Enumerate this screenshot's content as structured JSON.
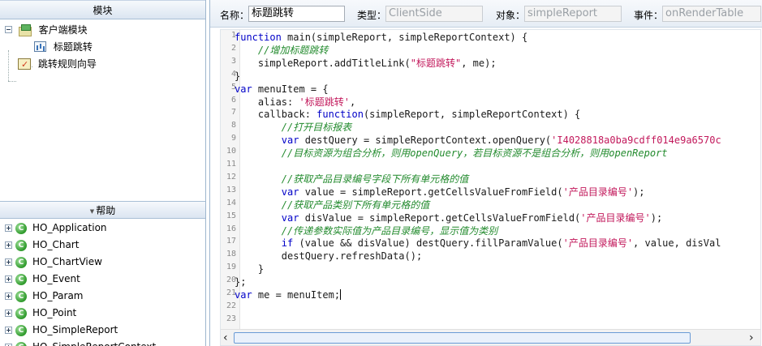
{
  "left": {
    "module_header": "模块",
    "tree": [
      {
        "label": "客户端模块",
        "icon": "folder-icon"
      },
      {
        "label": "标题跳转",
        "icon": "chart-icon"
      },
      {
        "label": "跳转规则向导",
        "icon": "guide-icon"
      }
    ],
    "help_header": "帮助",
    "help_items": [
      "HO_Application",
      "HO_Chart",
      "HO_ChartView",
      "HO_Event",
      "HO_Param",
      "HO_Point",
      "HO_SimpleReport",
      "HO_SimpleReportContext"
    ],
    "help_item_icon": "class-icon",
    "help_item_badge": "C"
  },
  "props": {
    "name_label": "名称：",
    "name_value": "标题跳转",
    "type_label": "类型：",
    "type_value": "ClientSide",
    "object_label": "对象：",
    "object_value": "simpleReport",
    "event_label": "事件：",
    "event_value": "onRenderTable"
  },
  "editor": {
    "line_numbers": [
      "1",
      "2",
      "3",
      "4",
      "5",
      "6",
      "7",
      "8",
      "9",
      "10",
      "11",
      "12",
      "13",
      "14",
      "15",
      "16",
      "17",
      "18",
      "19",
      "20",
      "21",
      "22",
      "23"
    ],
    "lines": [
      [
        {
          "t": "function",
          "c": "kw"
        },
        {
          "t": " main(simpleReport, simpleReportContext) {"
        }
      ],
      [
        {
          "t": "    "
        },
        {
          "t": "//增加标题跳转",
          "c": "cm"
        }
      ],
      [
        {
          "t": "    simpleReport.addTitleLink("
        },
        {
          "t": "\"标题跳转\"",
          "c": "str"
        },
        {
          "t": ", me);"
        }
      ],
      [
        {
          "t": "}"
        }
      ],
      [
        {
          "t": "var",
          "c": "kw"
        },
        {
          "t": " menuItem = {"
        }
      ],
      [
        {
          "t": "    alias: "
        },
        {
          "t": "'标题跳转'",
          "c": "str"
        },
        {
          "t": ","
        }
      ],
      [
        {
          "t": "    callback: "
        },
        {
          "t": "function",
          "c": "kw"
        },
        {
          "t": "(simpleReport, simpleReportContext) {"
        }
      ],
      [
        {
          "t": "        "
        },
        {
          "t": "//打开目标报表",
          "c": "cm"
        }
      ],
      [
        {
          "t": "        "
        },
        {
          "t": "var",
          "c": "kw"
        },
        {
          "t": " destQuery = simpleReportContext.openQuery("
        },
        {
          "t": "'I4028818a0ba9cdff014e9a6570c",
          "c": "str"
        }
      ],
      [
        {
          "t": "        "
        },
        {
          "t": "//目标资源为组合分析，则用openQuery，若目标资源不是组合分析，则用openReport",
          "c": "cm"
        }
      ],
      [
        {
          "t": ""
        }
      ],
      [
        {
          "t": "        "
        },
        {
          "t": "//获取产品目录编号字段下所有单元格的值",
          "c": "cm"
        }
      ],
      [
        {
          "t": "        "
        },
        {
          "t": "var",
          "c": "kw"
        },
        {
          "t": " value = simpleReport.getCellsValueFromField("
        },
        {
          "t": "'产品目录编号'",
          "c": "str"
        },
        {
          "t": ");"
        }
      ],
      [
        {
          "t": "        "
        },
        {
          "t": "//获取产品类别下所有单元格的值",
          "c": "cm"
        }
      ],
      [
        {
          "t": "        "
        },
        {
          "t": "var",
          "c": "kw"
        },
        {
          "t": " disValue = simpleReport.getCellsValueFromField("
        },
        {
          "t": "'产品目录编号'",
          "c": "str"
        },
        {
          "t": ");"
        }
      ],
      [
        {
          "t": "        "
        },
        {
          "t": "//传递参数实际值为产品目录编号，显示值为类别",
          "c": "cm"
        }
      ],
      [
        {
          "t": "        "
        },
        {
          "t": "if",
          "c": "kw"
        },
        {
          "t": " (value && disValue) destQuery.fillParamValue("
        },
        {
          "t": "'产品目录编号'",
          "c": "str"
        },
        {
          "t": ", value, disVal"
        }
      ],
      [
        {
          "t": "        destQuery.refreshData();"
        }
      ],
      [
        {
          "t": "    }"
        }
      ],
      [
        {
          "t": "};"
        }
      ],
      [
        {
          "t": "var",
          "c": "kw"
        },
        {
          "t": " me = menuItem;"
        }
      ],
      [
        {
          "t": ""
        }
      ],
      [
        {
          "t": ""
        }
      ]
    ],
    "cursor_line": 21,
    "scroll_left_arrow": "‹",
    "scroll_right_arrow": "›"
  }
}
